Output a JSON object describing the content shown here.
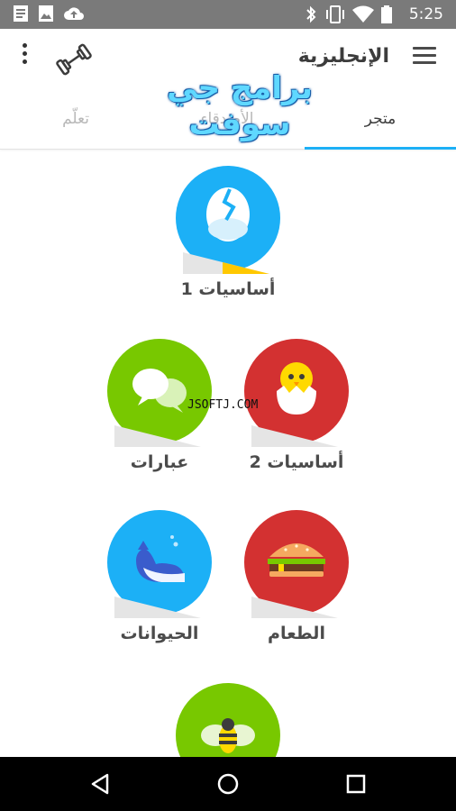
{
  "status_bar": {
    "time": "5:25",
    "left_icons": [
      "document-icon",
      "image-icon",
      "cloud-upload-icon"
    ],
    "right_icons": [
      "bluetooth-icon",
      "vibrate-icon",
      "wifi-icon",
      "battery-icon"
    ]
  },
  "app_bar": {
    "title": "الإنجليزية",
    "watermark": "برامج جي سوفت"
  },
  "tabs": [
    {
      "label": "تعلّم",
      "active": false
    },
    {
      "label": "الأصدقاء",
      "active": false
    },
    {
      "label": "متجر",
      "active": true
    }
  ],
  "watermark2": "JSOFTJ.COM",
  "skills": [
    {
      "label": "أساسيات 1",
      "color": "#1cb0f6",
      "icon": "egg-icon"
    },
    {
      "label": "عبارات",
      "color": "#78c800",
      "icon": "speech-bubbles-icon"
    },
    {
      "label": "أساسيات 2",
      "color": "#d33131",
      "icon": "chick-icon"
    },
    {
      "label": "الحيوانات",
      "color": "#1cb0f6",
      "icon": "whale-icon"
    },
    {
      "label": "الطعام",
      "color": "#d33131",
      "icon": "burger-icon"
    },
    {
      "label": "",
      "color": "#78c800",
      "icon": "bee-icon"
    }
  ],
  "colors": {
    "accent": "#1cb0f6",
    "green": "#78c800",
    "red": "#d33131",
    "progress_yellow": "#ffc800"
  },
  "nav": {
    "buttons": [
      "back-icon",
      "home-icon",
      "recents-icon"
    ]
  }
}
